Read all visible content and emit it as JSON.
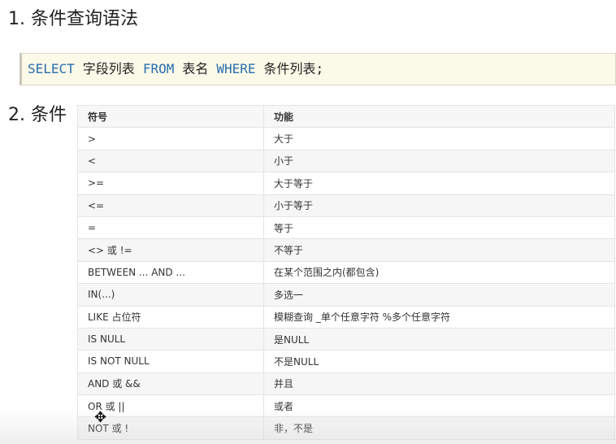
{
  "headings": {
    "section1": "1. 条件查询语法",
    "section2": "2. 条件"
  },
  "code": {
    "select": "SELECT",
    "fields": "字段列表",
    "from": "FROM",
    "table": "表名",
    "where": "WHERE",
    "conditions": "条件列表;"
  },
  "table": {
    "headers": [
      "符号",
      "功能"
    ],
    "rows": [
      {
        "symbol": ">",
        "function": "大于"
      },
      {
        "symbol": "<",
        "function": "小于"
      },
      {
        "symbol": ">=",
        "function": "大于等于"
      },
      {
        "symbol": "<=",
        "function": "小于等于"
      },
      {
        "symbol": "=",
        "function": "等于"
      },
      {
        "symbol": "<> 或 !=",
        "function": "不等于"
      },
      {
        "symbol": "BETWEEN ... AND ...",
        "function": "在某个范围之内(都包含)"
      },
      {
        "symbol": "IN(...)",
        "function": "多选一"
      },
      {
        "symbol": "LIKE 占位符",
        "function": "模糊查询 _单个任意字符 %多个任意字符"
      },
      {
        "symbol": "IS NULL",
        "function": "是NULL"
      },
      {
        "symbol": "IS NOT NULL",
        "function": "不是NULL"
      },
      {
        "symbol": "AND 或 &&",
        "function": "并且"
      },
      {
        "symbol": "OR 或 ||",
        "function": "或者"
      },
      {
        "symbol": "NOT 或 !",
        "function": "非，不是"
      }
    ]
  },
  "colors": {
    "keyword": "#2a6fb0",
    "code_background": "#fbf9e8",
    "header_background": "#f7f7f7"
  },
  "cursor_icon": "move-cursor-icon"
}
